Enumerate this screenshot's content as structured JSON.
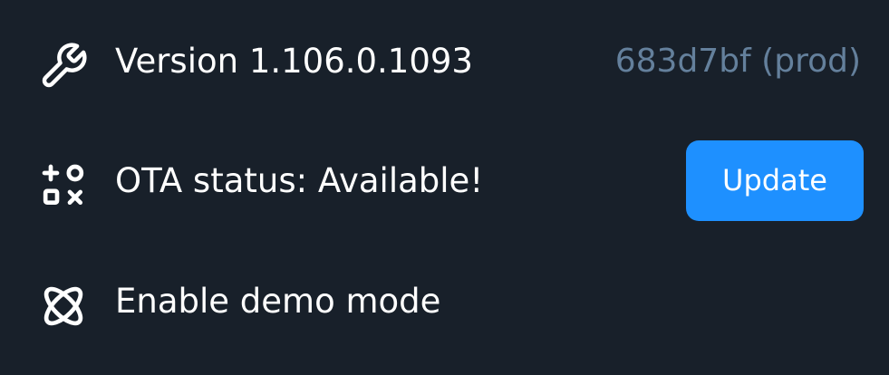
{
  "settings": {
    "version": {
      "icon": "wrench-icon",
      "label": "Version 1.106.0.1093",
      "build": "683d7bf (prod)"
    },
    "ota": {
      "icon": "shapes-icon",
      "label": "OTA status: Available!",
      "button_label": "Update"
    },
    "demo": {
      "icon": "atom-icon",
      "label": "Enable demo mode"
    }
  },
  "colors": {
    "background": "#18202a",
    "text": "#ffffff",
    "muted": "#64809c",
    "accent": "#1e90ff"
  }
}
